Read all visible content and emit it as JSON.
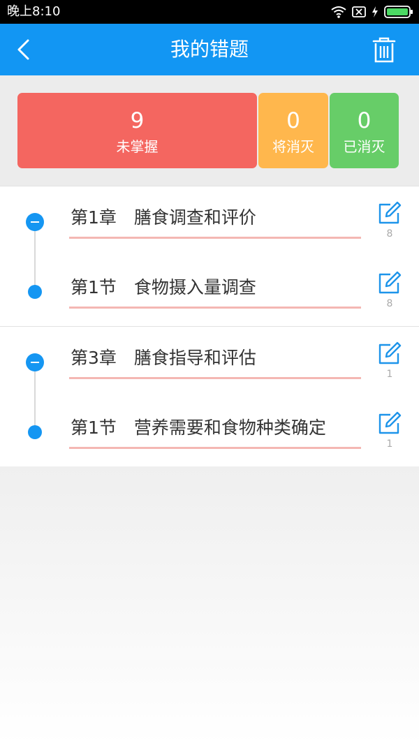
{
  "status_bar": {
    "time": "晚上8:10",
    "icons": [
      "wifi-icon",
      "sim-card-icon",
      "charging-icon",
      "battery-icon"
    ]
  },
  "app_bar": {
    "title": "我的错题",
    "back_icon": "chevron-left-icon",
    "delete_icon": "trash-icon"
  },
  "stats": [
    {
      "count": "9",
      "label": "未掌握",
      "color": "#f46660"
    },
    {
      "count": "0",
      "label": "将消灭",
      "color": "#ffb74d"
    },
    {
      "count": "0",
      "label": "已消灭",
      "color": "#67cd68"
    }
  ],
  "colors": {
    "accent": "#1296f3",
    "underline": "#f4b7b3"
  },
  "groups": [
    {
      "chapter": {
        "title": "第1章　膳食调查和评价",
        "count": "8"
      },
      "section": {
        "title": "第1节　食物摄入量调查",
        "count": "8"
      }
    },
    {
      "chapter": {
        "title": "第3章　膳食指导和评估",
        "count": "1"
      },
      "section": {
        "title": "第1节　营养需要和食物种类确定",
        "count": "1"
      }
    }
  ]
}
